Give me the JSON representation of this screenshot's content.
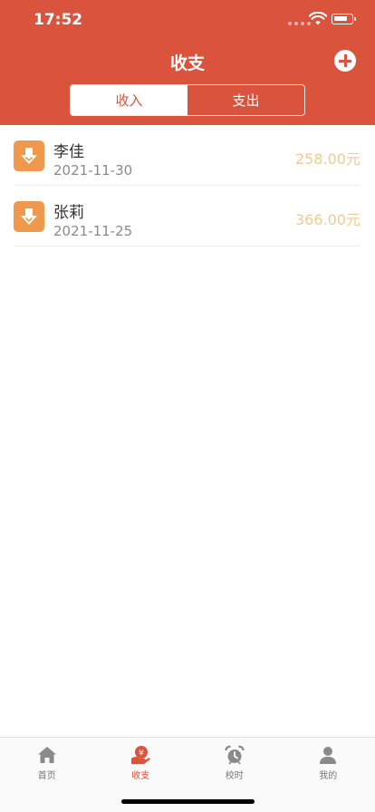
{
  "status_bar": {
    "time": "17:52"
  },
  "header": {
    "title": "收支"
  },
  "segments": [
    {
      "label": "收入",
      "active": true
    },
    {
      "label": "支出",
      "active": false
    }
  ],
  "records": [
    {
      "name": "李佳",
      "date": "2021-11-30",
      "amount": "258.00元",
      "icon": "download-arrow-icon"
    },
    {
      "name": "张莉",
      "date": "2021-11-25",
      "amount": "366.00元",
      "icon": "download-arrow-icon"
    }
  ],
  "tabbar": {
    "items": [
      {
        "label": "首页",
        "icon": "home-icon",
        "active": false
      },
      {
        "label": "收支",
        "icon": "income-expense-icon",
        "active": true
      },
      {
        "label": "校时",
        "icon": "alarm-clock-icon",
        "active": false
      },
      {
        "label": "我的",
        "icon": "person-icon",
        "active": false
      }
    ]
  },
  "colors": {
    "brand": "#d9533d",
    "icon_orange": "#f0994c",
    "amount": "#f3c98e"
  }
}
